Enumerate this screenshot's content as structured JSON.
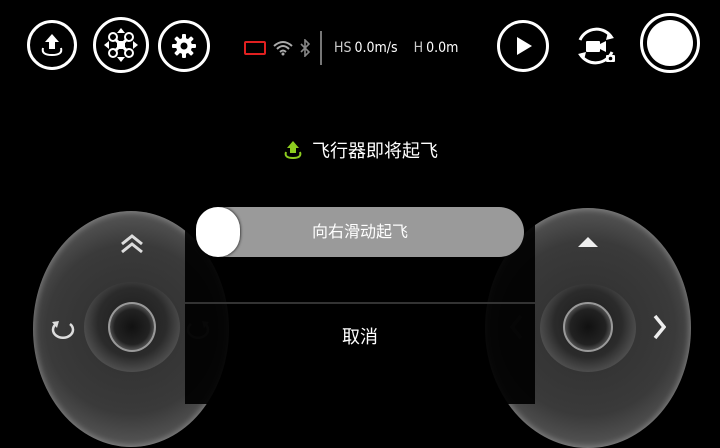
{
  "toolbar": {
    "takeoff_icon": "takeoff-icon",
    "drone_icon": "drone-icon",
    "settings_icon": "gear-icon",
    "play_icon": "play-icon",
    "camera_switch_icon": "camera-switch-icon",
    "shutter_icon": "shutter-icon"
  },
  "status": {
    "battery_color": "#e02020",
    "hs_label": "HS",
    "hs_value": "0.0m/s",
    "h_label": "H",
    "h_value": "0.0m"
  },
  "takeoff_prompt": {
    "message": "飞行器即将起飞",
    "icon_color": "#8ccc1f"
  },
  "dialog": {
    "slider_label": "向右滑动起飞",
    "slider_progress": 0,
    "cancel_label": "取消"
  }
}
